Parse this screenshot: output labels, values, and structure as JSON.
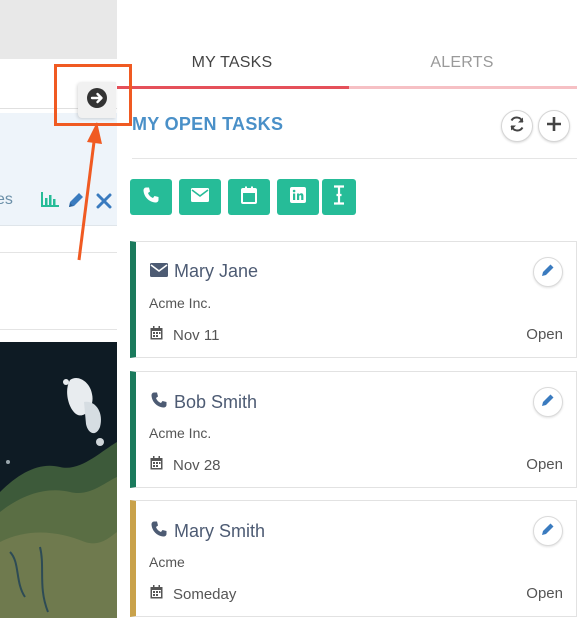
{
  "left_app": {
    "tab_text_fragment": "es"
  },
  "panel": {
    "tabs": [
      {
        "label": "MY TASKS",
        "active": true
      },
      {
        "label": "ALERTS",
        "active": false
      }
    ],
    "section_title": "MY OPEN TASKS",
    "header_buttons": [
      {
        "icon": "refresh-icon"
      },
      {
        "icon": "plus-icon"
      }
    ],
    "action_buttons": [
      {
        "icon": "phone-icon"
      },
      {
        "icon": "envelope-icon"
      },
      {
        "icon": "calendar-icon"
      },
      {
        "icon": "linkedin-icon"
      },
      {
        "icon": "text-cursor-icon"
      }
    ],
    "tasks": [
      {
        "type_icon": "envelope-icon",
        "name": "Mary Jane",
        "company": "Acme Inc.",
        "date": "Nov 11",
        "status": "Open",
        "accent": "#1a7a5c"
      },
      {
        "type_icon": "phone-icon",
        "name": "Bob Smith",
        "company": "Acme Inc.",
        "date": "Nov 28",
        "status": "Open",
        "accent": "#1a7a5c"
      },
      {
        "type_icon": "phone-icon",
        "name": "Mary Smith",
        "company": "Acme",
        "date": "Someday",
        "status": "Open",
        "accent": "#c9a24b"
      }
    ]
  },
  "colors": {
    "accent_green": "#26bc98",
    "title_blue": "#4a90c8",
    "tab_active_red": "#e5505a",
    "annotation_orange": "#f05a22"
  }
}
